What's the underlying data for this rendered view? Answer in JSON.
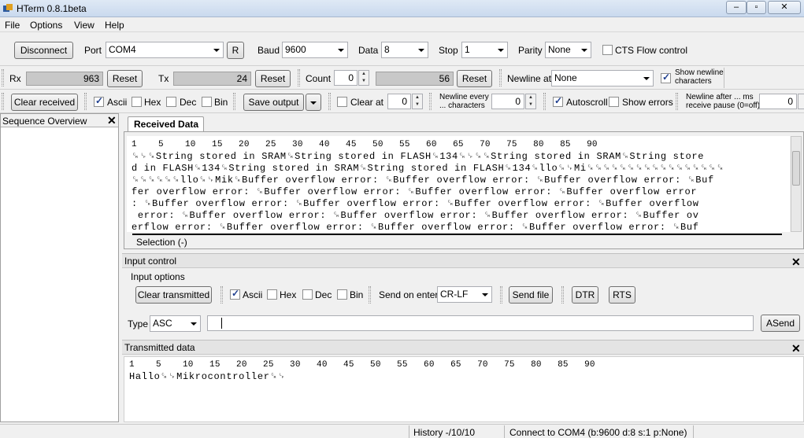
{
  "window": {
    "title": "HTerm 0.8.1beta",
    "controls": [
      "–",
      "▫",
      "✕"
    ]
  },
  "menu": [
    "File",
    "Options",
    "View",
    "Help"
  ],
  "connection": {
    "disconnect_label": "Disconnect",
    "port_label": "Port",
    "port_value": "COM4",
    "r_label": "R",
    "baud_label": "Baud",
    "baud_value": "9600",
    "data_label": "Data",
    "data_value": "8",
    "stop_label": "Stop",
    "stop_value": "1",
    "parity_label": "Parity",
    "parity_value": "None",
    "cts_label": "CTS Flow control"
  },
  "counters": {
    "rx_label": "Rx",
    "rx_value": "963",
    "rx_reset": "Reset",
    "tx_label": "Tx",
    "tx_value": "24",
    "tx_reset": "Reset",
    "count_label": "Count",
    "count_value": "0",
    "count_display": "56",
    "count_reset": "Reset",
    "newline_at_label": "Newline at",
    "newline_at_value": "None",
    "show_newline_label_1": "Show newline",
    "show_newline_label_2": "characters"
  },
  "receive_toolbar": {
    "clear_received": "Clear received",
    "ascii": "Ascii",
    "hex": "Hex",
    "dec": "Dec",
    "bin": "Bin",
    "save_output": "Save output",
    "clear_at": "Clear at",
    "clear_at_value": "0",
    "newline_every_1": "Newline every",
    "newline_every_2": "... characters",
    "newline_every_value": "0",
    "autoscroll": "Autoscroll",
    "show_errors": "Show errors",
    "newline_after_1": "Newline after ... ms",
    "newline_after_2": "receive pause (0=off)",
    "newline_after_value": "0"
  },
  "sequence_overview": {
    "title": "Sequence Overview"
  },
  "received": {
    "tab": "Received Data",
    "ruler": "1    5    10   15   20   25   30   40   45   50   55   60   65   70   75   80   85   90",
    "lines": [
      "␍␊␍String stored in SRAM␍String stored in FLASH␍134␍␊␍␍String stored in SRAM␍String store",
      "d in FLASH␍134␍String stored in SRAM␍String stored in FLASH␍134␍llo␍␊Mi␍␍␍␍␍␍␍␍␍␍␍␍␍␍␍␍␍",
      "␍␍␍␍␍␍llo␍␊Mik␍Buffer overflow error: ␍Buffer overflow error: ␍Buffer overflow error: ␍Buf",
      "fer overflow error: ␍Buffer overflow error: ␍Buffer overflow error: ␍Buffer overflow error",
      ": ␍Buffer overflow error: ␍Buffer overflow error: ␍Buffer overflow error: ␍Buffer overflow",
      " error: ␍Buffer overflow error: ␍Buffer overflow error: ␍Buffer overflow error: ␍Buffer ov",
      "erflow error: ␍Buffer overflow error: ␍Buffer overflow error: ␍Buffer overflow error: ␍Buf"
    ],
    "selection": "Selection (-)"
  },
  "input_control": {
    "title": "Input control",
    "options_label": "Input options",
    "clear_transmitted": "Clear transmitted",
    "ascii": "Ascii",
    "hex": "Hex",
    "dec": "Dec",
    "bin": "Bin",
    "send_on_enter_label": "Send on enter",
    "send_on_enter_value": "CR-LF",
    "send_file": "Send file",
    "dtr": "DTR",
    "rts": "RTS",
    "type_label": "Type",
    "type_value": "ASC",
    "input_value": "",
    "asend": "ASend"
  },
  "transmitted": {
    "title": "Transmitted data",
    "ruler": "1    5    10   15   20   25   30   40   45   50   55   60   65   70   75   80   85   90",
    "lines": [
      "Hallo␍␊Mikrocontroller␍␊"
    ]
  },
  "status": {
    "history": "History -/10/10",
    "connection": "Connect to COM4 (b:9600 d:8 s:1 p:None)"
  }
}
